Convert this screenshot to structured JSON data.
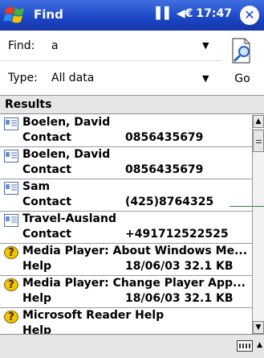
{
  "titlebar": {
    "title": "Find",
    "time": "17:47",
    "signal": "▌▌",
    "volume": "◀€",
    "close": "✕"
  },
  "find": {
    "label": "Find:",
    "value": "a"
  },
  "type": {
    "label": "Type:",
    "value": "All data"
  },
  "go": {
    "label": "Go"
  },
  "results": {
    "header": "Results",
    "items": [
      {
        "name": "Boelen, David",
        "type": "Contact",
        "detail": "0856435679",
        "kind": "contact"
      },
      {
        "name": "Boelen, David",
        "type": "Contact",
        "detail": "0856435679",
        "kind": "contact"
      },
      {
        "name": "Sam",
        "type": "Contact",
        "detail": "(425)8764325",
        "kind": "contact"
      },
      {
        "name": "Travel-Ausland",
        "type": "Contact",
        "detail": "+491712522525",
        "kind": "contact"
      },
      {
        "name": "Media Player: About Windows Me...",
        "type": "Help",
        "detail": "18/06/03  32.1 KB",
        "kind": "help"
      },
      {
        "name": "Media Player: Change Player App...",
        "type": "Help",
        "detail": "18/06/03  32.1 KB",
        "kind": "help"
      },
      {
        "name": "Microsoft Reader Help",
        "type": "Help",
        "detail": "",
        "kind": "help"
      }
    ]
  },
  "icons": {
    "start": "windows-flag-icon",
    "go": "magnifier-page-icon",
    "contact": "contact-card-icon",
    "help": "help-question-icon",
    "keyboard": "keyboard-icon"
  },
  "colors": {
    "titlebar": "#1c45c4",
    "help_icon": "#f2c500"
  }
}
